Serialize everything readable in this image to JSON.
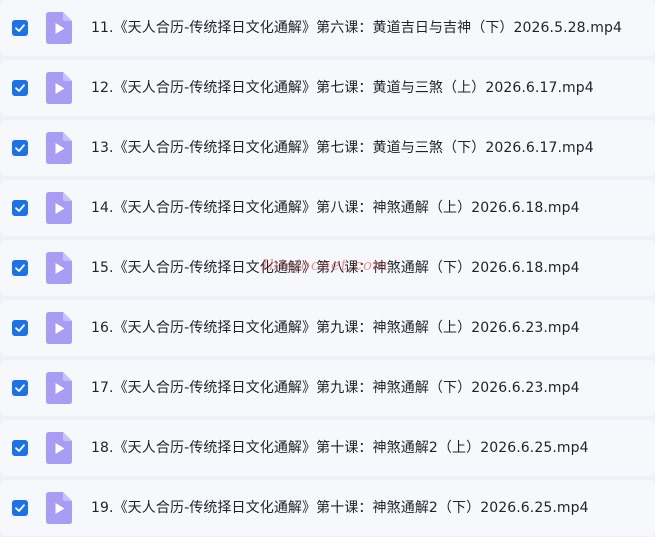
{
  "files": [
    {
      "name": "11.《天人合历-传统择日文化通解》第六课：黄道吉日与吉神（下）2026.5.28.mp4",
      "checked": true,
      "icon": "video-file-icon"
    },
    {
      "name": "12.《天人合历-传统择日文化通解》第七课：黄道与三煞（上）2026.6.17.mp4",
      "checked": true,
      "icon": "video-file-icon"
    },
    {
      "name": "13.《天人合历-传统择日文化通解》第七课：黄道与三煞（下）2026.6.17.mp4",
      "checked": true,
      "icon": "video-file-icon"
    },
    {
      "name": "14.《天人合历-传统择日文化通解》第八课：神煞通解（上）2026.6.18.mp4",
      "checked": true,
      "icon": "video-file-icon"
    },
    {
      "name": "15.《天人合历-传统择日文化通解》第八课：神煞通解（下）2026.6.18.mp4",
      "checked": true,
      "icon": "video-file-icon"
    },
    {
      "name": "16.《天人合历-传统择日文化通解》第九课：神煞通解（上）2026.6.23.mp4",
      "checked": true,
      "icon": "video-file-icon"
    },
    {
      "name": "17.《天人合历-传统择日文化通解》第九课：神煞通解（下）2026.6.23.mp4",
      "checked": true,
      "icon": "video-file-icon"
    },
    {
      "name": "18.《天人合历-传统择日文化通解》第十课：神煞通解2（上）2026.6.25.mp4",
      "checked": true,
      "icon": "video-file-icon"
    },
    {
      "name": "19.《天人合历-传统择日文化通解》第十课：神煞通解2（下）2026.6.25.mp4",
      "checked": true,
      "icon": "video-file-icon"
    }
  ],
  "watermark": "Ibiejocnet.com",
  "colors": {
    "checkbox": "#1a73e8",
    "icon_bg": "#a89cf5",
    "icon_play": "#ffffff",
    "row_bg": "#f7f8fc",
    "page_bg": "#eef1f7",
    "text": "#1f2329"
  }
}
